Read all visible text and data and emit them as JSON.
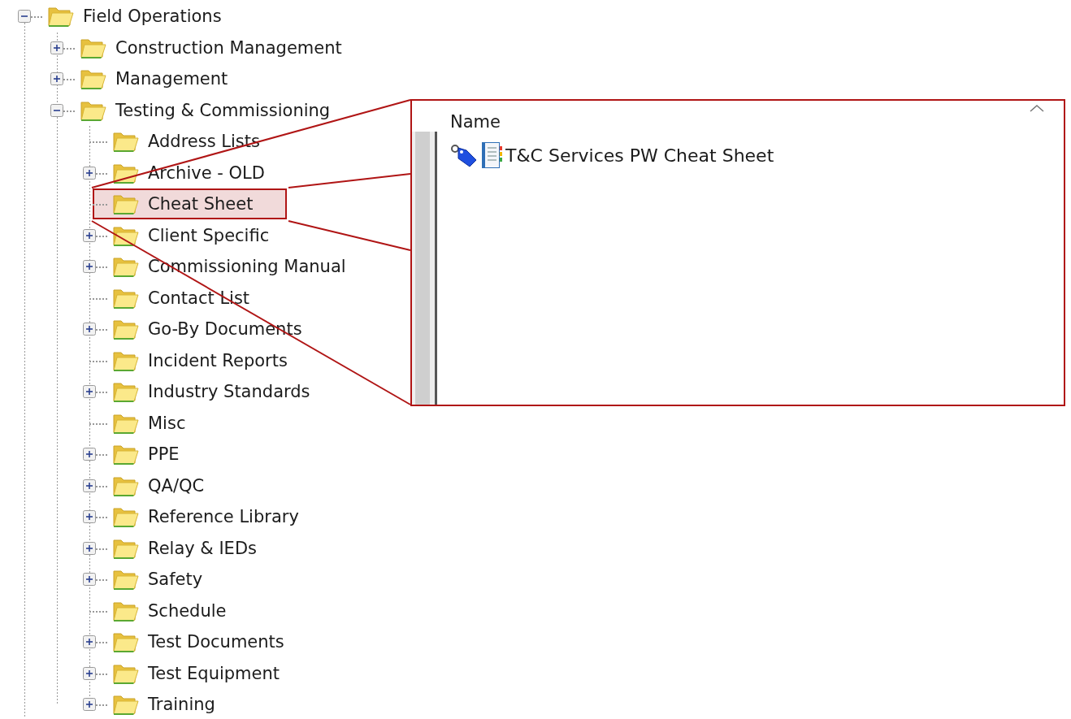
{
  "tree": [
    {
      "label": "Field Operations",
      "kind": "branch",
      "expanded": true,
      "selected": false,
      "children": [
        {
          "label": "Construction Management",
          "kind": "branch",
          "expanded": false,
          "selected": false
        },
        {
          "label": "Management",
          "kind": "branch",
          "expanded": false,
          "selected": false
        },
        {
          "label": "Testing & Commissioning",
          "kind": "branch",
          "expanded": true,
          "selected": false,
          "children": [
            {
              "label": "Address Lists",
              "kind": "leaf",
              "selected": false
            },
            {
              "label": "Archive - OLD",
              "kind": "branch",
              "expanded": false,
              "selected": false
            },
            {
              "label": "Cheat Sheet",
              "kind": "leaf",
              "selected": true
            },
            {
              "label": "Client Specific",
              "kind": "branch",
              "expanded": false,
              "selected": false
            },
            {
              "label": "Commissioning Manual",
              "kind": "branch",
              "expanded": false,
              "selected": false
            },
            {
              "label": "Contact List",
              "kind": "leaf",
              "selected": false
            },
            {
              "label": "Go-By Documents",
              "kind": "branch",
              "expanded": false,
              "selected": false
            },
            {
              "label": "Incident Reports",
              "kind": "leaf",
              "selected": false
            },
            {
              "label": "Industry Standards",
              "kind": "branch",
              "expanded": false,
              "selected": false
            },
            {
              "label": "Misc",
              "kind": "leaf",
              "selected": false
            },
            {
              "label": "PPE",
              "kind": "branch",
              "expanded": false,
              "selected": false
            },
            {
              "label": "QA/QC",
              "kind": "branch",
              "expanded": false,
              "selected": false
            },
            {
              "label": "Reference Library",
              "kind": "branch",
              "expanded": false,
              "selected": false
            },
            {
              "label": "Relay & IEDs",
              "kind": "branch",
              "expanded": false,
              "selected": false
            },
            {
              "label": "Safety",
              "kind": "branch",
              "expanded": false,
              "selected": false
            },
            {
              "label": "Schedule",
              "kind": "leaf",
              "selected": false
            },
            {
              "label": "Test Documents",
              "kind": "branch",
              "expanded": false,
              "selected": false
            },
            {
              "label": "Test Equipment",
              "kind": "branch",
              "expanded": false,
              "selected": false
            },
            {
              "label": "Training",
              "kind": "branch",
              "expanded": false,
              "selected": false
            }
          ]
        }
      ]
    }
  ],
  "callout": {
    "header": "Name",
    "items": [
      {
        "label": "T&C Services PW Cheat Sheet"
      }
    ]
  }
}
